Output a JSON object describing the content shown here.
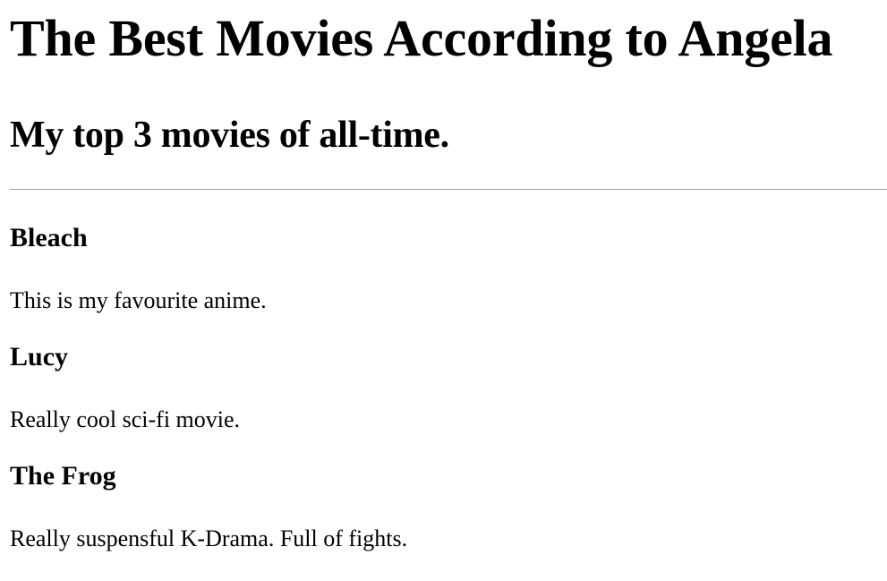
{
  "page": {
    "title": "The Best Movies According to Angela",
    "subtitle": "My top 3 movies of all-time."
  },
  "movies": [
    {
      "title": "Bleach",
      "review": "This is my favourite anime."
    },
    {
      "title": "Lucy",
      "review": "Really cool sci-fi movie."
    },
    {
      "title": "The Frog",
      "review": "Really suspensful K-Drama. Full of fights."
    }
  ]
}
